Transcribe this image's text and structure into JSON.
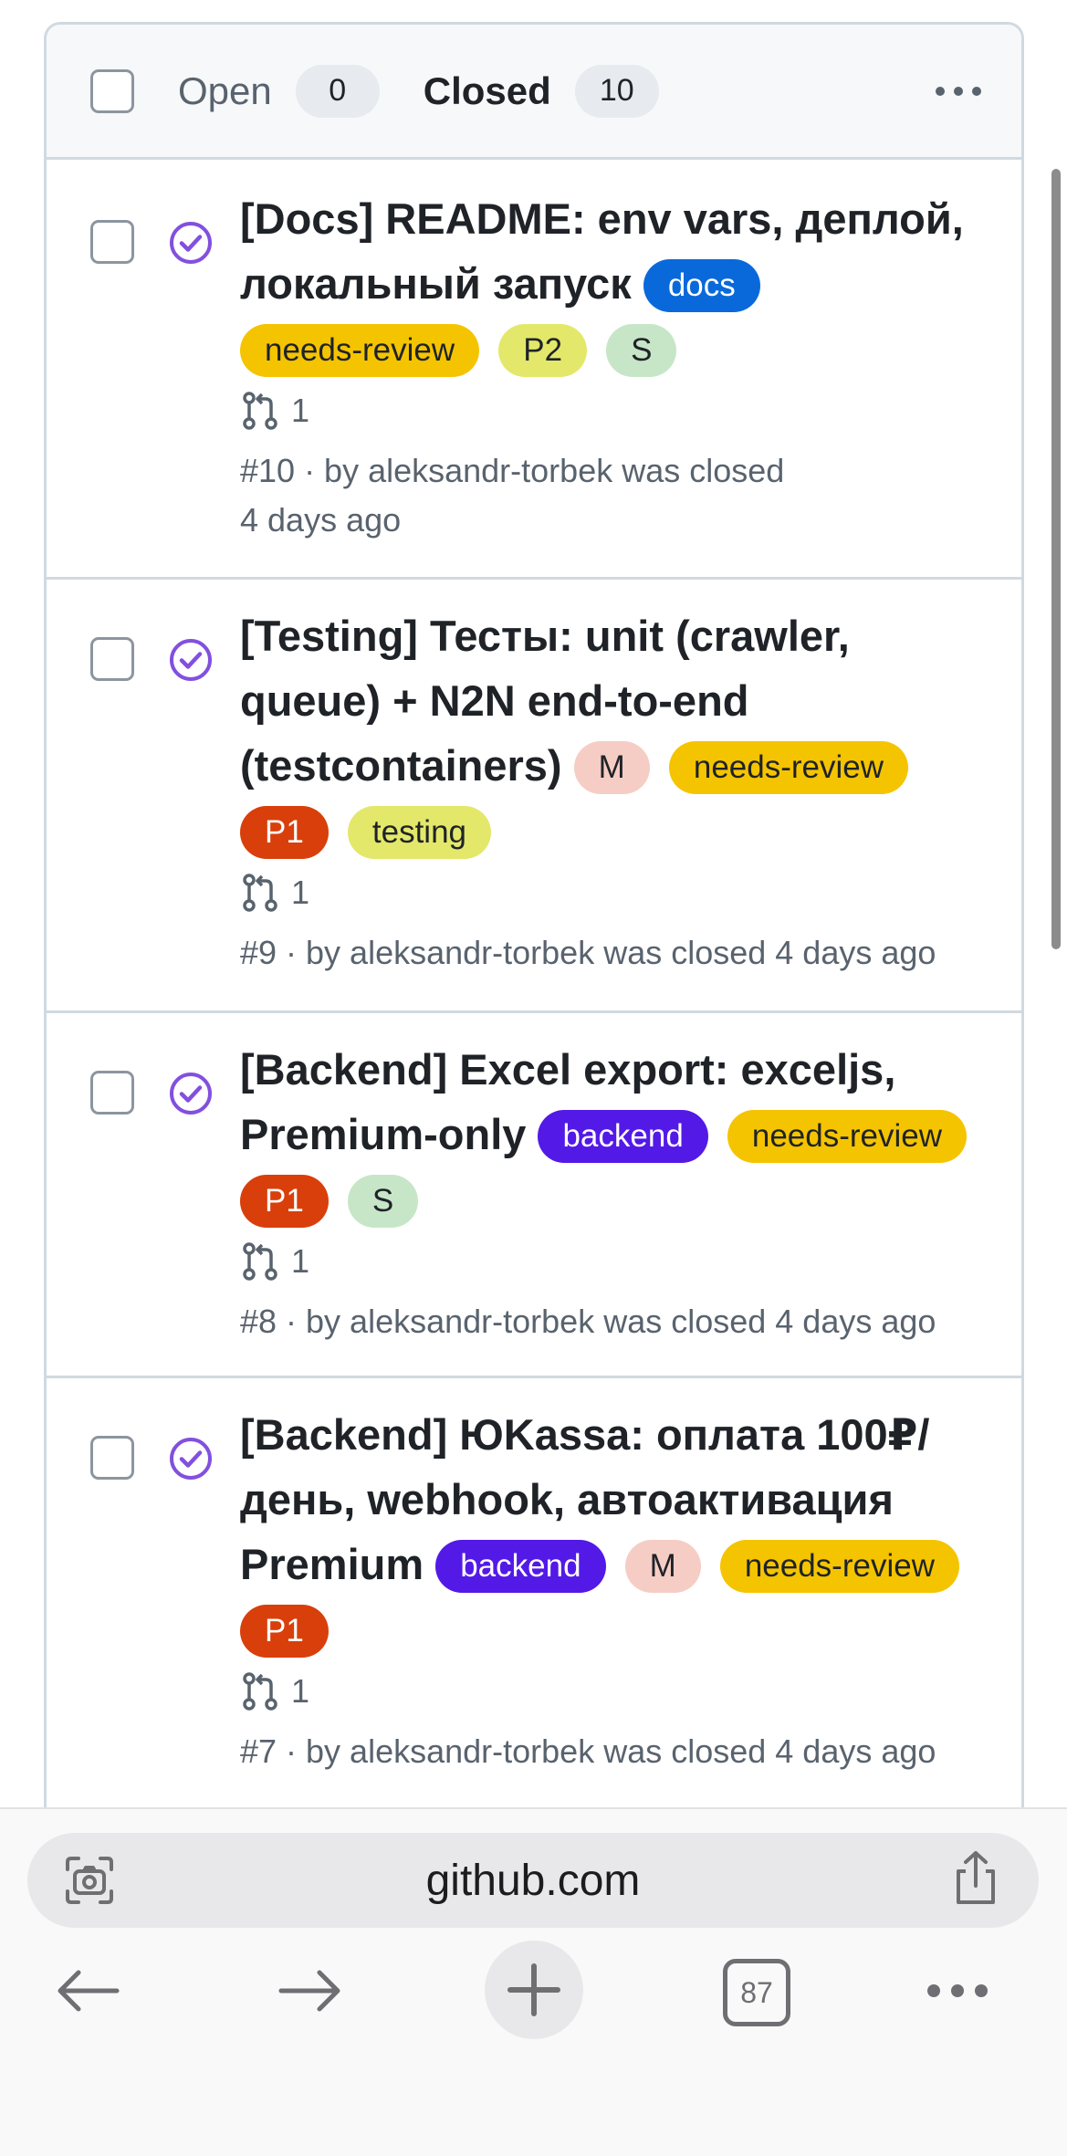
{
  "header": {
    "open_label": "Open",
    "open_count": "0",
    "closed_label": "Closed",
    "closed_count": "10"
  },
  "issues": [
    {
      "title": "[Docs] README: env vars, деплой, локальный запуск",
      "labels": [
        {
          "text": "docs",
          "bg": "#0969da",
          "fg": "#ffffff"
        },
        {
          "text": "needs-review",
          "bg": "#f5c400",
          "fg": "#1f2328"
        },
        {
          "text": "P2",
          "bg": "#e3e86a",
          "fg": "#1f2328"
        },
        {
          "text": "S",
          "bg": "#c7e6c7",
          "fg": "#1f2328"
        }
      ],
      "pr_count": "1",
      "meta_line1": "#10 · by aleksandr-torbek was closed",
      "meta_line2": "4 days ago"
    },
    {
      "title": "[Testing] Тесты: unit (crawler, queue) + N2N end-to-end (testcontainers)",
      "labels": [
        {
          "text": "M",
          "bg": "#f6cdc5",
          "fg": "#1f2328"
        },
        {
          "text": "needs-review",
          "bg": "#f5c400",
          "fg": "#1f2328"
        },
        {
          "text": "P1",
          "bg": "#d93f0b",
          "fg": "#ffffff"
        },
        {
          "text": "testing",
          "bg": "#e3e86a",
          "fg": "#1f2328"
        }
      ],
      "pr_count": "1",
      "meta": "#9 · by aleksandr-torbek was closed 4 days ago"
    },
    {
      "title": "[Backend] Excel export: exceljs, Premium-only",
      "labels": [
        {
          "text": "backend",
          "bg": "#5319e7",
          "fg": "#ffffff"
        },
        {
          "text": "needs-review",
          "bg": "#f5c400",
          "fg": "#1f2328"
        },
        {
          "text": "P1",
          "bg": "#d93f0b",
          "fg": "#ffffff"
        },
        {
          "text": "S",
          "bg": "#c7e6c7",
          "fg": "#1f2328"
        }
      ],
      "pr_count": "1",
      "meta": "#8 · by aleksandr-torbek was closed 4 days ago"
    },
    {
      "title": "[Backend] ЮKassa: оплата 100₽/день, webhook, автоактивация Premium",
      "labels": [
        {
          "text": "backend",
          "bg": "#5319e7",
          "fg": "#ffffff"
        },
        {
          "text": "M",
          "bg": "#f6cdc5",
          "fg": "#1f2328"
        },
        {
          "text": "needs-review",
          "bg": "#f5c400",
          "fg": "#1f2328"
        },
        {
          "text": "P1",
          "bg": "#d93f0b",
          "fg": "#ffffff"
        }
      ],
      "pr_count": "1",
      "meta": "#7 · by aleksandr-torbek was closed 4 days ago"
    }
  ],
  "browser": {
    "url": "github.com",
    "tab_count": "87"
  },
  "colors": {
    "closed_icon": "#8250df",
    "border": "#d1d9e0",
    "muted_text": "#59636e"
  },
  "icons": {
    "state": "check-circle-icon",
    "pr": "pull-request-icon",
    "more": "kebab-icon",
    "screen": "visual-search-icon",
    "share": "share-icon",
    "back": "arrow-left-icon",
    "forward": "arrow-right-icon",
    "new_tab": "plus-icon",
    "tabs": "tabs-icon",
    "menu": "more-icon"
  }
}
